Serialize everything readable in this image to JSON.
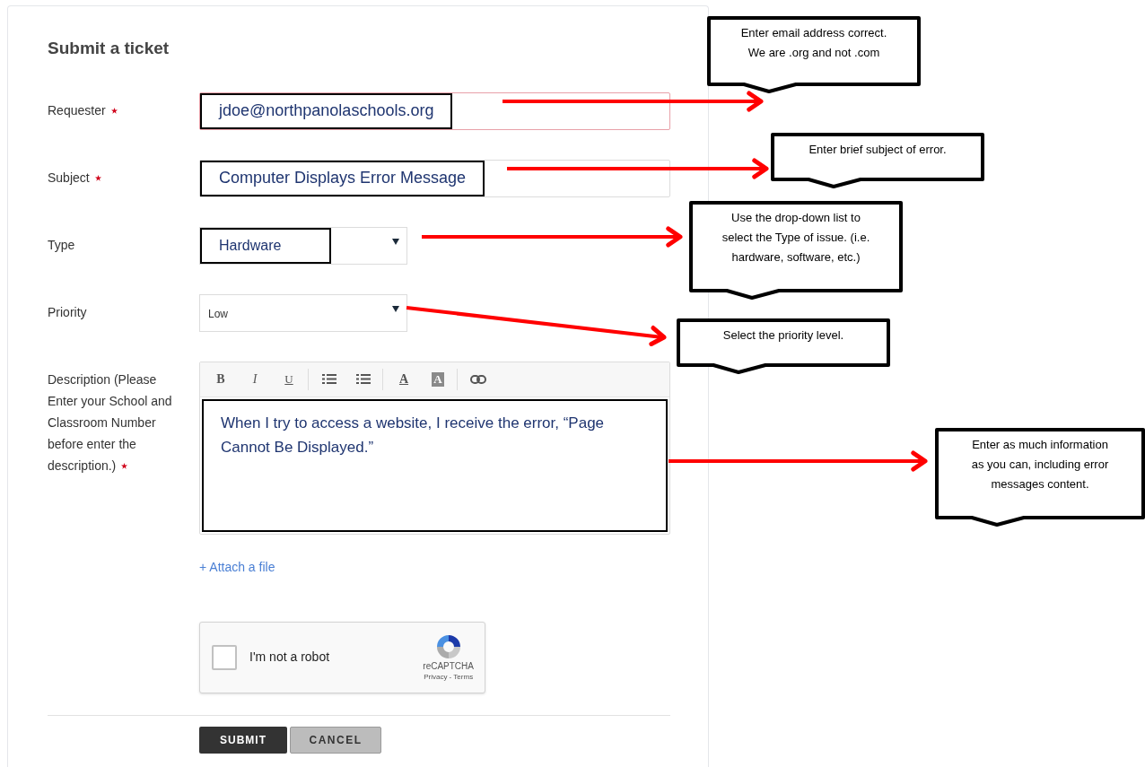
{
  "form": {
    "title": "Submit a ticket",
    "fields": [
      {
        "kind": "text",
        "label": "Requester",
        "required": true,
        "value": "jdoe@northpanolaschools.org",
        "invalid": true
      },
      {
        "kind": "text",
        "label": "Subject",
        "required": true,
        "value": "Computer Displays Error Message",
        "invalid": false
      },
      {
        "kind": "select",
        "label": "Type",
        "required": false,
        "value": "Hardware",
        "highlighted": true
      },
      {
        "kind": "select",
        "label": "Priority",
        "required": false,
        "value": "Low",
        "highlighted": false
      },
      {
        "kind": "editor",
        "label": "Description (Please Enter your School and Classroom Number before enter the description.)",
        "required": true,
        "value": "When I try to access a website, I receive the error, “Page Cannot Be Displayed.”",
        "toolbar": [
          [
            {
              "kind": "bold",
              "label": "B"
            },
            {
              "kind": "italic",
              "label": "I"
            },
            {
              "kind": "underline",
              "label": "U"
            }
          ],
          [
            {
              "kind": "bulleted-list"
            },
            {
              "kind": "numbered-list"
            }
          ],
          [
            {
              "kind": "text-color",
              "label": "A"
            },
            {
              "kind": "background-color",
              "label": "A"
            }
          ],
          [
            {
              "kind": "link"
            }
          ]
        ]
      }
    ],
    "attach_link": "+ Attach a file",
    "captcha": {
      "label": "I'm not a robot",
      "checked": false,
      "brand": "reCAPTCHA",
      "links": "Privacy - Terms"
    },
    "buttons": [
      {
        "kind": "primary",
        "label": "SUBMIT"
      },
      {
        "kind": "secondary",
        "label": "CANCEL"
      }
    ]
  },
  "callouts": [
    {
      "text": "Enter email address correct.\nWe are .org and not .com"
    },
    {
      "text": "Enter brief subject of error."
    },
    {
      "text": "Use the drop-down list to\nselect the Type of issue. (i.e.\nhardware, software, etc.)"
    },
    {
      "text": "Select the priority level."
    },
    {
      "text": "Enter as much information\nas you can, including error\nmessages content."
    }
  ]
}
